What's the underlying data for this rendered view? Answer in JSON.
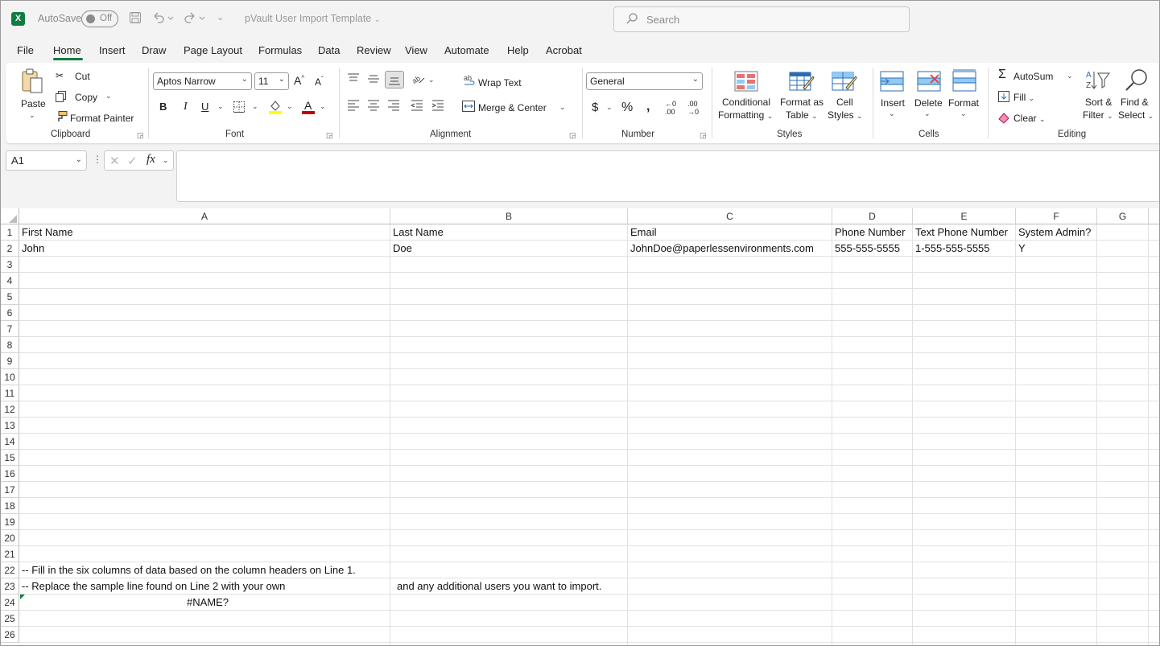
{
  "titlebar": {
    "autosave_label": "AutoSave",
    "autosave_state": "Off",
    "doc_title": "pVault User Import Template",
    "search_placeholder": "Search"
  },
  "menu": {
    "tabs": [
      "File",
      "Home",
      "Insert",
      "Draw",
      "Page Layout",
      "Formulas",
      "Data",
      "Review",
      "View",
      "Automate",
      "Help",
      "Acrobat"
    ],
    "active": "Home"
  },
  "ribbon": {
    "clipboard": {
      "paste": "Paste",
      "cut": "Cut",
      "copy": "Copy",
      "format_painter": "Format Painter",
      "label": "Clipboard"
    },
    "font": {
      "name": "Aptos Narrow",
      "size": "11",
      "bold": "B",
      "italic": "I",
      "underline": "U",
      "label": "Font",
      "font_color": "#c00000",
      "highlight_color": "#ffff00"
    },
    "alignment": {
      "wrap": "Wrap Text",
      "merge": "Merge & Center",
      "label": "Alignment"
    },
    "number": {
      "format": "General",
      "label": "Number"
    },
    "styles": {
      "conditional1": "Conditional",
      "conditional2": "Formatting",
      "table1": "Format as",
      "table2": "Table",
      "cell1": "Cell",
      "cell2": "Styles",
      "label": "Styles"
    },
    "cells": {
      "insert": "Insert",
      "delete": "Delete",
      "format": "Format",
      "label": "Cells"
    },
    "editing": {
      "autosum": "AutoSum",
      "fill": "Fill",
      "clear": "Clear",
      "sort1": "Sort &",
      "sort2": "Filter",
      "find1": "Find &",
      "find2": "Select",
      "label": "Editing"
    }
  },
  "formula_bar": {
    "name_box": "A1",
    "fx": "fx",
    "content": ""
  },
  "sheet": {
    "columns": [
      "A",
      "B",
      "C",
      "D",
      "E",
      "F",
      "G"
    ],
    "rows": [
      "1",
      "2",
      "3",
      "4",
      "5",
      "6",
      "7",
      "8",
      "9",
      "10",
      "11",
      "12",
      "13",
      "14",
      "15",
      "16",
      "17",
      "18",
      "19",
      "20",
      "21",
      "22",
      "23",
      "24",
      "25",
      "26"
    ],
    "cells": {
      "A1": "First Name",
      "B1": "Last Name",
      "C1": "Email",
      "D1": "Phone Number",
      "E1": "Text Phone Number",
      "F1": "System Admin?",
      "A2": "John",
      "B2": "Doe",
      "C2": "JohnDoe@paperlessenvironments.com",
      "D2": "555-555-5555",
      "E2": "1-555-555-5555",
      "F2": "Y",
      "A22": "-- Fill in the six columns of data based on the column headers on Line 1.",
      "A23": "-- Replace the sample line found on Line 2 with your own",
      "B23": "and any additional users you want to import.",
      "A24": "#NAME?"
    }
  }
}
